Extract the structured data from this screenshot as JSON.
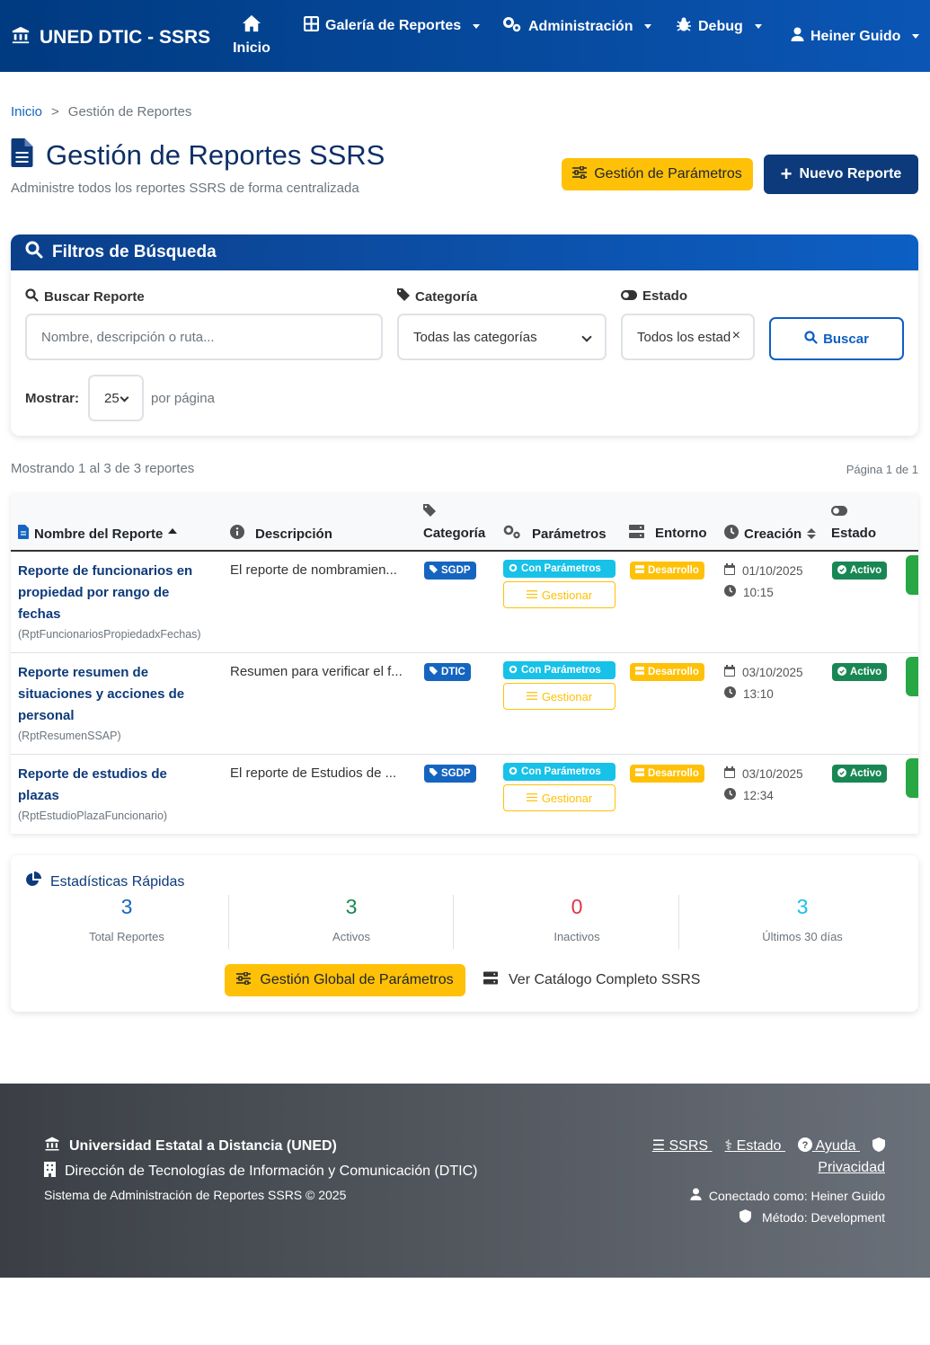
{
  "nav": {
    "brand": "UNED DTIC - SSRS",
    "home": "Inicio",
    "gallery": "Galería de Reportes",
    "admin": "Administración",
    "debug": "Debug",
    "user": "Heiner Guido"
  },
  "breadcrumb": {
    "home": "Inicio",
    "separator": ">",
    "current": "Gestión de Reportes"
  },
  "header": {
    "title": "Gestión de Reportes SSRS",
    "subtitle": "Administre todos los reportes SSRS de forma centralizada",
    "params_button": "Gestión de Parámetros",
    "new_button": "Nuevo Reporte"
  },
  "filters": {
    "title": "Filtros de Búsqueda",
    "search_label": "Buscar Reporte",
    "search_placeholder": "Nombre, descripción o ruta...",
    "category_label": "Categoría",
    "category_value": "Todas las categorías",
    "status_label": "Estado",
    "status_value": "Todos los estad",
    "search_button": "Buscar",
    "show_label": "Mostrar:",
    "per_page_value": "25",
    "per_page_text": "por página"
  },
  "results": {
    "showing": "Mostrando 1 al 3 de 3 reportes",
    "page": "Página 1 de 1"
  },
  "table": {
    "headers": {
      "name": "Nombre del Reporte",
      "description": "Descripción",
      "category": "Categoría",
      "parameters": "Parámetros",
      "environment": "Entorno",
      "created": "Creación",
      "status": "Estado"
    },
    "rows": [
      {
        "name_lines": [
          "Reporte de funcionarios en",
          "propiedad por rango de",
          "fechas"
        ],
        "code": "(RptFuncionariosPropiedadxFechas)",
        "description": "El reporte de nombramien...",
        "category": "SGDP",
        "params": "Con Parámetros",
        "manage": "Gestionar",
        "env": "Desarrollo",
        "date": "01/10/2025",
        "time": "10:15",
        "status": "Activo"
      },
      {
        "name_lines": [
          "Reporte resumen de",
          "situaciones y acciones de",
          "personal"
        ],
        "code": "(RptResumenSSAP)",
        "description": "Resumen para verificar el f...",
        "category": "DTIC",
        "params": "Con Parámetros",
        "manage": "Gestionar",
        "env": "Desarrollo",
        "date": "03/10/2025",
        "time": "13:10",
        "status": "Activo"
      },
      {
        "name_lines": [
          "Reporte de estudios de",
          "plazas"
        ],
        "code": "(RptEstudioPlazaFuncionario)",
        "description": "El reporte de Estudios de ...",
        "category": "SGDP",
        "params": "Con Parámetros",
        "manage": "Gestionar",
        "env": "Desarrollo",
        "date": "03/10/2025",
        "time": "12:34",
        "status": "Activo"
      }
    ]
  },
  "stats": {
    "title": "Estadísticas Rápidas",
    "items": [
      {
        "value": "3",
        "label": "Total Reportes",
        "color": "#1565c0"
      },
      {
        "value": "3",
        "label": "Activos",
        "color": "#198754"
      },
      {
        "value": "0",
        "label": "Inactivos",
        "color": "#dc3545"
      },
      {
        "value": "3",
        "label": "Últimos 30 días",
        "color": "#17c1e8"
      }
    ],
    "global_button": "Gestión Global de Parámetros",
    "catalog_link": "Ver Catálogo Completo SSRS"
  },
  "footer": {
    "university": "Universidad Estatal a Distancia (UNED)",
    "direction": "Dirección de Tecnologías de Información y Comunicación (DTIC)",
    "system": "Sistema de Administración de Reportes SSRS © 2025",
    "link_ssrs": "SSRS",
    "link_status": "Estado",
    "link_help": "Ayuda",
    "link_privacy": "Privacidad",
    "connected": "Conectado como: Heiner Guido",
    "method": "Método: Development"
  },
  "colors": {
    "primary": "#0d3a7a",
    "accent_blue": "#1565c0",
    "warning": "#ffc107",
    "info": "#17c1e8",
    "success": "#198754"
  }
}
